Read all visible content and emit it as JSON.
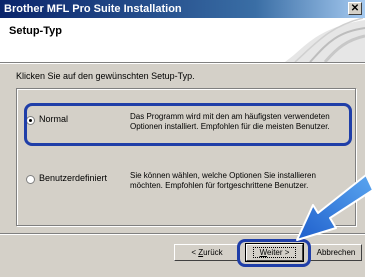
{
  "window": {
    "title": "Brother MFL Pro Suite Installation",
    "close_glyph": "✕"
  },
  "header": {
    "title": "Setup-Typ"
  },
  "instruction": "Klicken Sie auf den gewünschten Setup-Typ.",
  "options": [
    {
      "label": "Normal",
      "selected": true,
      "description": "Das Programm wird mit den am häufigsten verwendeten Optionen installiert. Empfohlen für die meisten Benutzer."
    },
    {
      "label": "Benutzerdefiniert",
      "selected": false,
      "description": "Sie können wählen, welche Optionen Sie installieren möchten. Empfohlen für fortgeschrittene Benutzer."
    }
  ],
  "buttons": {
    "back_prefix": "< ",
    "back_mnemonic": "Z",
    "back_rest": "urück",
    "next_mnemonic": "W",
    "next_rest": "eiter >",
    "cancel": "Abbrechen"
  },
  "colors": {
    "highlight": "#1f3ea8",
    "arrow": "#1f6fd6"
  }
}
